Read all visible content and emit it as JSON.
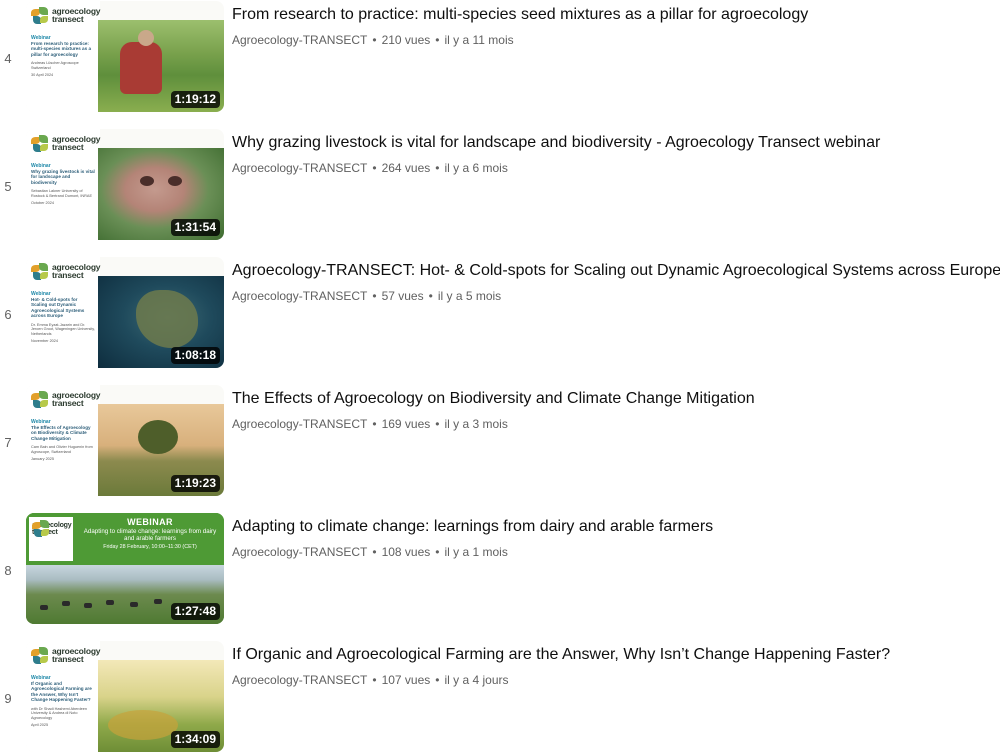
{
  "videos": [
    {
      "index": "4",
      "title": "From research to practice: multi-species seed mixtures as a pillar for agroecology",
      "channel": "Agroecology-TRANSECT",
      "views": "210 vues",
      "age": "il y a 11 mois",
      "duration": "1:19:12"
    },
    {
      "index": "5",
      "title": "Why grazing livestock is vital for landscape and biodiversity - Agroecology Transect webinar",
      "channel": "Agroecology-TRANSECT",
      "views": "264 vues",
      "age": "il y a 6 mois",
      "duration": "1:31:54"
    },
    {
      "index": "6",
      "title": "Agroecology-TRANSECT: Hot- & Cold-spots for Scaling out Dynamic Agroecological Systems across Europe",
      "channel": "Agroecology-TRANSECT",
      "views": "57 vues",
      "age": "il y a 5 mois",
      "duration": "1:08:18"
    },
    {
      "index": "7",
      "title": "The Effects of Agroecology on Biodiversity and Climate Change Mitigation",
      "channel": "Agroecology-TRANSECT",
      "views": "169 vues",
      "age": "il y a 3 mois",
      "duration": "1:19:23"
    },
    {
      "index": "8",
      "title": "Adapting to climate change: learnings from dairy and arable farmers",
      "channel": "Agroecology-TRANSECT",
      "views": "108 vues",
      "age": "il y a 1 mois",
      "duration": "1:27:48"
    },
    {
      "index": "9",
      "title": "If Organic and Agroecological Farming are the Answer, Why Isn’t Change Happening Faster?",
      "channel": "Agroecology-TRANSECT",
      "views": "107 vues",
      "age": "il y a 4 jours",
      "duration": "1:34:09"
    }
  ],
  "thumbnails": {
    "logo_line1": "agroecology",
    "logo_line2": "transect",
    "kicker": "Webinar",
    "t4": {
      "title": "From research to practice: multi-species mixtures as a pillar for agroecology",
      "by": "Andreas Lüscher Agroscope Switzerland",
      "date": "30 April 2024"
    },
    "t5": {
      "title": "Why grazing livestock is vital for landscape and biodiversity",
      "by": "Sebastian Lakner University of Rostock & Bertrand Dumont, INRAE",
      "date": "October 2024"
    },
    "t6": {
      "title": "Hot- & Cold-spots for Scaling out Dynamic Agroecological Systems across Europe",
      "by": "Dr. Emma Eyzat-Jazarin and Dr. Jeroen Groot, Wageningen University, Netherlands",
      "date": "November 2024"
    },
    "t7": {
      "title": "The Effects of Agroecology on Biodiversity & Climate Change Mitigation",
      "by": "Cam Bain and Olivier Huguenin from Agroscope, Switzerland",
      "date": "January 2025"
    },
    "t8": {
      "kicker": "WEBINAR",
      "title": "Adapting to climate change: learnings from dairy and arable farmers",
      "date": "Friday 28 February, 10:00–11:30 (CET)"
    },
    "t9": {
      "title": "If Organic and Agroecological Farming are the Answer, Why Isn't Change Happening Faster?",
      "by": "with Dr Shadi Hashemi Aberdeen University & Andrea di Noto Agroecology",
      "date": "April 2025"
    }
  },
  "icons": {
    "logo": "agroecology-transect-logo"
  },
  "colors": {
    "duration_bg": "#000000cc",
    "title": "#0f0f0f",
    "meta": "#606060",
    "webinar_green": "#4e9a35"
  }
}
